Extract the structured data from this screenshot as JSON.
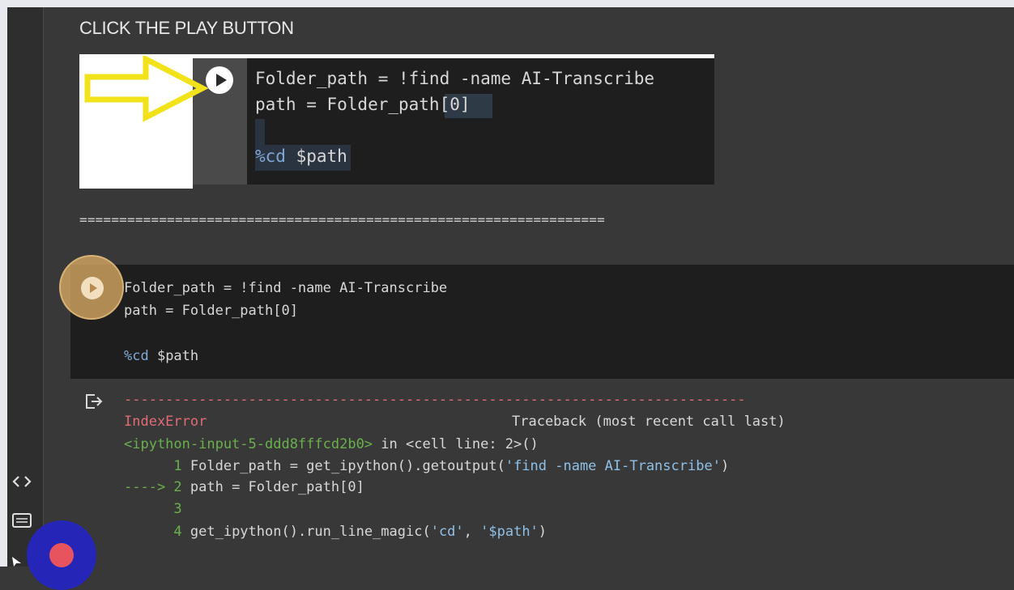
{
  "heading": "CLICK THE PLAY BUTTON",
  "screenshot_example": {
    "line1": "Folder_path = !find -name AI-Transcribe",
    "line2_prefix": "path = Folder_path",
    "line2_index": "[0]",
    "line4_magic": "%cd",
    "line4_arg": " $path"
  },
  "divider": "==================================================================",
  "cell": {
    "line1": "Folder_path = !find -name AI-Transcribe",
    "line2": "path = Folder_path[0]",
    "line3_magic": "%cd",
    "line3_arg": " $path"
  },
  "output": {
    "dash_line": "---------------------------------------------------------------------------",
    "error_name": "IndexError",
    "traceback_header": "Traceback (most recent call last)",
    "ipython_ref": "<ipython-input-5-ddd8fffcd2b0>",
    "in_cell": " in <cell line: 2>()",
    "tb1_num": "      1 ",
    "tb1_code_a": "Folder_path = get_ipython().getoutput(",
    "tb1_str": "'find -name AI-Transcribe'",
    "tb1_code_b": ")",
    "tb2_arrow": "----> 2 ",
    "tb2_code": "path = Folder_path[0]",
    "tb3_num": "      3",
    "tb4_num": "      4 ",
    "tb4_code_a": "get_ipython().run_line_magic(",
    "tb4_str1": "'cd'",
    "tb4_sep": ", ",
    "tb4_str2": "'$path'",
    "tb4_code_b": ")"
  },
  "icons": {
    "run": "play-icon",
    "output": "output-arrow-icon",
    "code": "code-brackets-icon",
    "terminal": "terminal-icon"
  },
  "colors": {
    "error": "#e06c75",
    "traceback_green": "#6ab04c",
    "string_blue": "#8ec0e8",
    "highlight": "#daaa64",
    "record_blue": "#2526b8"
  }
}
